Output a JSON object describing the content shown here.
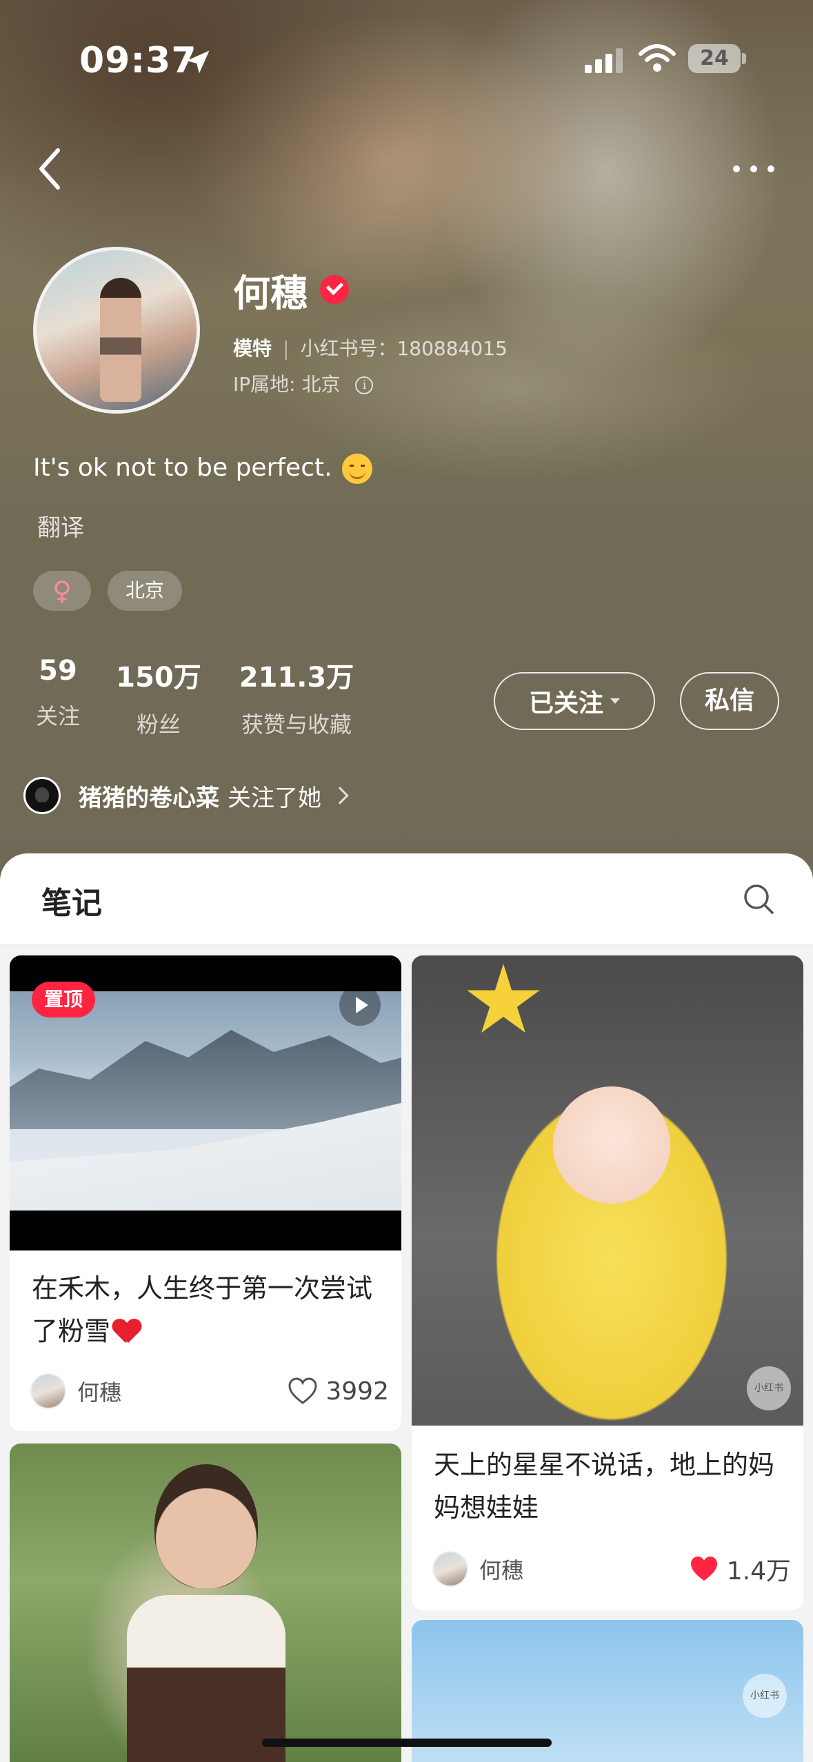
{
  "status_bar": {
    "time": "09:37",
    "battery": "24"
  },
  "profile": {
    "name": "何穗",
    "role": "模特",
    "red_id_label": "小红书号：",
    "red_id": "180884015",
    "ip_label": "IP属地: 北京",
    "bio": "It's ok not to be perfect.",
    "translate": "翻译",
    "tags": {
      "gender": "♀",
      "city": "北京"
    },
    "stats": [
      {
        "value": "59",
        "label": "关注"
      },
      {
        "value": "150万",
        "label": "粉丝"
      },
      {
        "value": "211.3万",
        "label": "获赞与收藏"
      }
    ],
    "follow_button": "已关注",
    "message_button": "私信",
    "mutual": {
      "name": "猪猪的卷心菜",
      "text": "关注了她"
    }
  },
  "notes": {
    "title": "笔记",
    "cards": [
      {
        "pinned": "置顶",
        "title": "在禾木，人生终于第一次尝试了粉雪",
        "author": "何穗",
        "likes": "3992",
        "liked": false
      },
      {
        "title": "天上的星星不说话，地上的妈妈想娃娃",
        "author": "何穗",
        "likes": "1.4万",
        "liked": true,
        "watermark": "小红书"
      },
      {
        "title": ""
      },
      {
        "watermark": "小红书"
      }
    ]
  },
  "colors": {
    "brand_red": "#ff2442",
    "verified": "#ff2442"
  },
  "icons": {
    "back": "chevron-left-icon",
    "more": "more-dots-icon",
    "search": "search-icon",
    "like_empty": "heart-outline-icon",
    "like_filled": "heart-filled-icon"
  }
}
